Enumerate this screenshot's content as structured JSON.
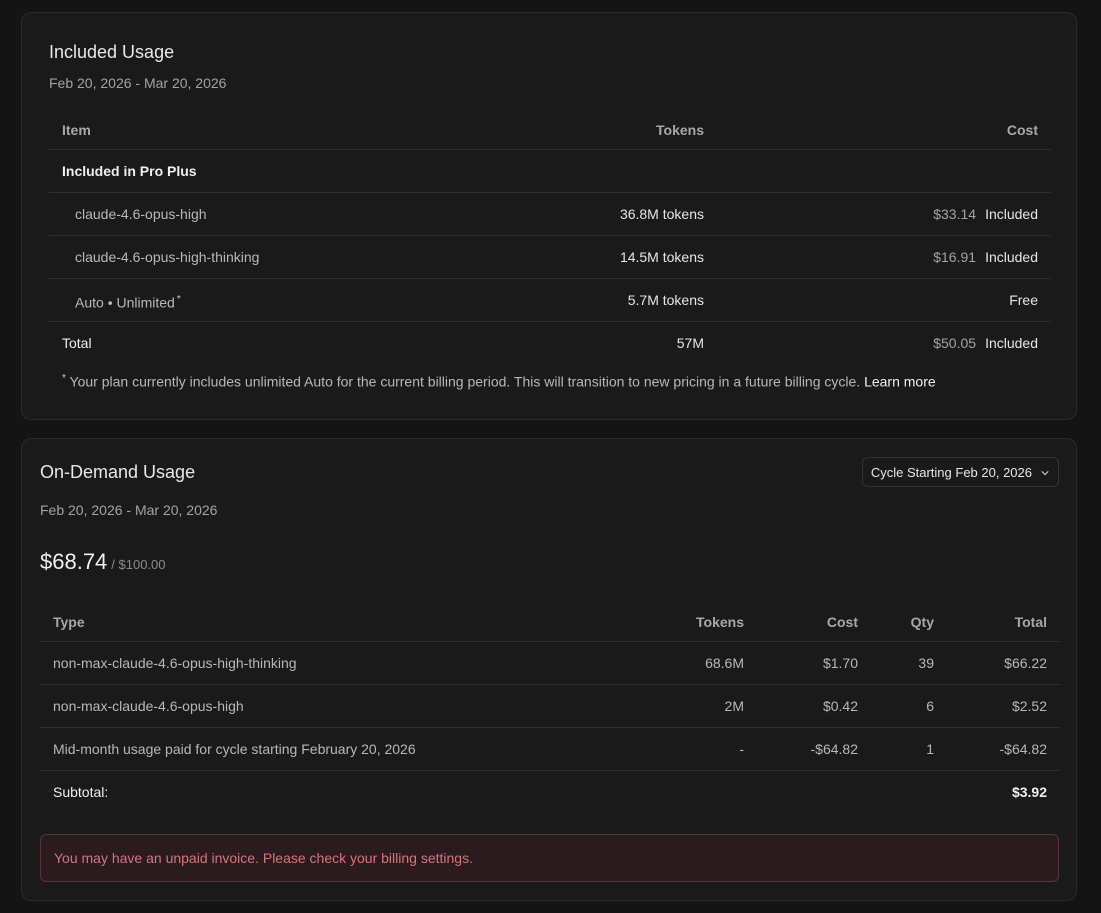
{
  "included": {
    "title": "Included Usage",
    "date_range": "Feb 20, 2026 - Mar 20, 2026",
    "columns": {
      "item": "Item",
      "tokens": "Tokens",
      "cost": "Cost"
    },
    "group_label": "Included in Pro Plus",
    "rows": [
      {
        "item": "claude-4.6-opus-high",
        "tokens": "36.8M tokens",
        "amount": "$33.14",
        "status": "Included"
      },
      {
        "item": "claude-4.6-opus-high-thinking",
        "tokens": "14.5M tokens",
        "amount": "$16.91",
        "status": "Included"
      },
      {
        "item": "Auto • Unlimited",
        "marker": "*",
        "tokens": "5.7M tokens",
        "amount": "",
        "status": "Free"
      }
    ],
    "total": {
      "label": "Total",
      "tokens": "57M",
      "amount": "$50.05",
      "status": "Included"
    },
    "footnote": {
      "marker": "*",
      "text": "Your plan currently includes unlimited Auto for the current billing period. This will transition to new pricing in a future billing cycle.",
      "link": "Learn more"
    }
  },
  "ondemand": {
    "title": "On-Demand Usage",
    "date_range": "Feb 20, 2026 - Mar 20, 2026",
    "cycle_select": "Cycle Starting Feb 20, 2026",
    "spent": "$68.74",
    "limit": "/ $100.00",
    "columns": {
      "type": "Type",
      "tokens": "Tokens",
      "cost": "Cost",
      "qty": "Qty",
      "total": "Total"
    },
    "rows": [
      {
        "type": "non-max-claude-4.6-opus-high-thinking",
        "tokens": "68.6M",
        "cost": "$1.70",
        "qty": "39",
        "total": "$66.22"
      },
      {
        "type": "non-max-claude-4.6-opus-high",
        "tokens": "2M",
        "cost": "$0.42",
        "qty": "6",
        "total": "$2.52"
      },
      {
        "type": "Mid-month usage paid for cycle starting February 20, 2026",
        "tokens": "-",
        "cost": "-$64.82",
        "qty": "1",
        "total": "-$64.82"
      }
    ],
    "subtotal_label": "Subtotal:",
    "subtotal_value": "$3.92",
    "alert": "You may have an unpaid invoice. Please check your billing settings."
  },
  "colors": {
    "background": "#141414",
    "card": "#1a1a1a",
    "alert_bg": "#2a1c1e",
    "alert_text": "#d9737a"
  }
}
